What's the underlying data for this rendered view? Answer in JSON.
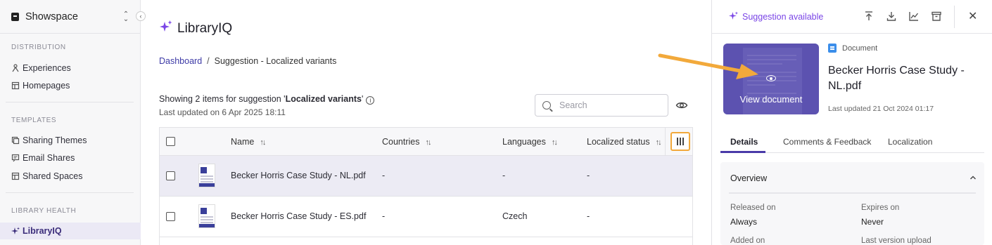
{
  "workspace": {
    "name": "Showspace"
  },
  "sidebar": {
    "sections": [
      {
        "title": "DISTRIBUTION",
        "items": [
          {
            "label": "Experiences",
            "icon": "experiences-icon"
          },
          {
            "label": "Homepages",
            "icon": "homepage-icon"
          }
        ]
      },
      {
        "title": "TEMPLATES",
        "items": [
          {
            "label": "Sharing Themes",
            "icon": "theme-icon"
          },
          {
            "label": "Email Shares",
            "icon": "email-share-icon"
          },
          {
            "label": "Shared Spaces",
            "icon": "shared-space-icon"
          }
        ]
      },
      {
        "title": "LIBRARY HEALTH",
        "items": [
          {
            "label": "LibraryIQ",
            "icon": "sparkle-icon",
            "active": true
          }
        ]
      }
    ]
  },
  "main": {
    "title": "LibraryIQ",
    "breadcrumb": {
      "root": "Dashboard",
      "separator": "/",
      "current": "Suggestion - Localized variants"
    },
    "summary": {
      "prefix": "Showing 2 items for suggestion '",
      "suggestion": "Localized variants",
      "suffix": "'"
    },
    "updated": "Last updated on 6 Apr 2025 18:11",
    "search": {
      "placeholder": "Search"
    }
  },
  "table": {
    "columns": {
      "name": "Name",
      "countries": "Countries",
      "languages": "Languages",
      "status": "Localized status"
    },
    "rows": [
      {
        "name": "Becker Horris Case Study - NL.pdf",
        "countries": "-",
        "languages": "-",
        "status": "-",
        "selected": true
      },
      {
        "name": "Becker Horris Case Study - ES.pdf",
        "countries": "-",
        "languages": "Czech",
        "status": "-",
        "selected": false
      }
    ]
  },
  "panel": {
    "suggestion": "Suggestion available",
    "preview_label": "View document",
    "doc_type": "Document",
    "doc_title": "Becker Horris Case Study - NL.pdf",
    "doc_updated": "Last updated 21 Oct 2024 01:17",
    "tabs": [
      "Details",
      "Comments & Feedback",
      "Localization"
    ],
    "overview": {
      "title": "Overview",
      "fields": [
        {
          "label": "Released on",
          "value": "Always"
        },
        {
          "label": "Expires on",
          "value": "Never"
        },
        {
          "label": "Added on",
          "value": ""
        },
        {
          "label": "Last version upload",
          "value": ""
        }
      ]
    }
  },
  "colors": {
    "accent": "#7a45e6",
    "highlight": "#f2a93b",
    "nav_active_bg": "#ebe9f5"
  }
}
